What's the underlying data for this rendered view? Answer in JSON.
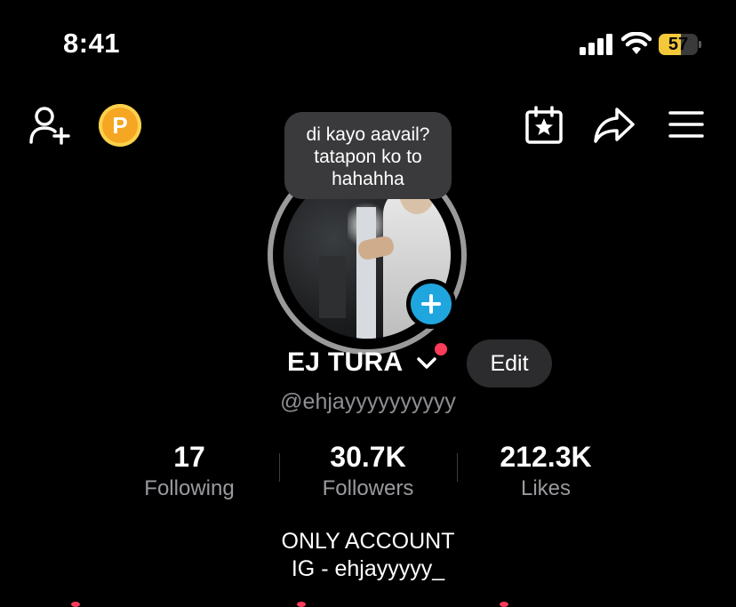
{
  "status_bar": {
    "time": "8:41",
    "battery_level": "57",
    "battery_color": "#f3c93a"
  },
  "top_bar": {
    "coin_label": "P",
    "icons": [
      "add-friend-icon",
      "coin-icon",
      "calendar-star-icon",
      "share-icon",
      "menu-icon"
    ]
  },
  "note": {
    "text": "di kayo aavail?\ntatapon ko to\nhahahha"
  },
  "profile": {
    "name": "EJ TURA",
    "edit_label": "Edit",
    "username": "@ehjayyyyyyyyyy"
  },
  "stats": [
    {
      "value": "17",
      "label": "Following"
    },
    {
      "value": "30.7K",
      "label": "Followers"
    },
    {
      "value": "212.3K",
      "label": "Likes"
    }
  ],
  "bio": {
    "line1": "ONLY ACCOUNT",
    "line2": "IG - ehjayyyyy_"
  },
  "colors": {
    "accent_red": "#ff3b5c",
    "plus_blue": "#20a6de",
    "coin_orange": "#f5a623"
  }
}
